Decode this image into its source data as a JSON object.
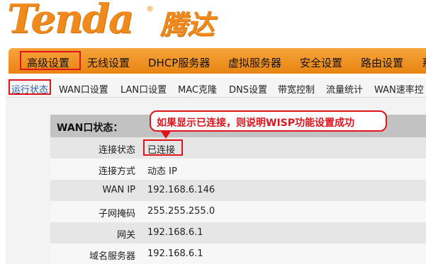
{
  "brand": {
    "logo_en": "Tenda",
    "logo_reg": "®",
    "logo_cn": "腾达",
    "accent_color": "#f08a1c"
  },
  "main_nav": {
    "items": [
      "高级设置",
      "无线设置",
      "DHCP服务器",
      "虚拟服务器",
      "安全设置",
      "路由设置",
      "系"
    ],
    "active": "高级设置"
  },
  "sub_nav": {
    "items": [
      "运行状态",
      "WAN口设置",
      "LAN口设置",
      "MAC克隆",
      "DNS设置",
      "带宽控制",
      "流量统计",
      "WAN速率控"
    ],
    "active": "运行状态"
  },
  "wan_status": {
    "title": "WAN口状态：",
    "rows": [
      {
        "label": "连接状态",
        "value": "已连接"
      },
      {
        "label": "连接方式",
        "value": "动态 IP"
      },
      {
        "label": "WAN IP",
        "value": "192.168.6.146"
      },
      {
        "label": "子网掩码",
        "value": "255.255.255.0"
      },
      {
        "label": "网关",
        "value": "192.168.6.1"
      },
      {
        "label": "域名服务器",
        "value": "192.168.6.1"
      }
    ]
  },
  "annotation": {
    "text": "如果显示已连接，则说明WISP功能设置成功",
    "color": "#e0141b"
  }
}
